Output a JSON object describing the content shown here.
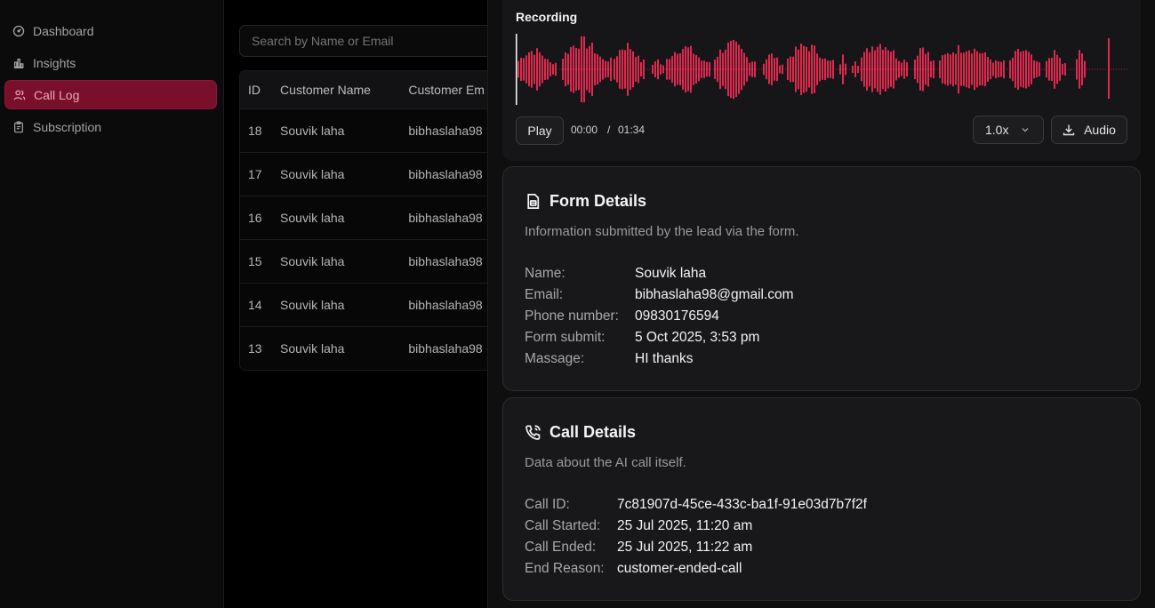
{
  "sidebar": {
    "items": [
      {
        "label": "Dashboard",
        "icon": "gauge-icon",
        "active": false
      },
      {
        "label": "Insights",
        "icon": "bar-chart-icon",
        "active": false
      },
      {
        "label": "Call Log",
        "icon": "users-icon",
        "active": true
      },
      {
        "label": "Subscription",
        "icon": "clipboard-icon",
        "active": false
      }
    ]
  },
  "search": {
    "placeholder": "Search by Name or Email"
  },
  "table": {
    "headers": [
      "ID",
      "Customer Name",
      "Customer Em"
    ],
    "rows": [
      [
        "18",
        "Souvik laha",
        "bibhaslaha98"
      ],
      [
        "17",
        "Souvik laha",
        "bibhaslaha98"
      ],
      [
        "16",
        "Souvik laha",
        "bibhaslaha98"
      ],
      [
        "15",
        "Souvik laha",
        "bibhaslaha98"
      ],
      [
        "14",
        "Souvik laha",
        "bibhaslaha98"
      ],
      [
        "13",
        "Souvik laha",
        "bibhaslaha98"
      ]
    ]
  },
  "recording": {
    "title": "Recording",
    "play_label": "Play",
    "current_time": "00:00",
    "separator": "/",
    "duration": "01:34",
    "speed": "1.0x",
    "download_label": "Audio",
    "progress": 0,
    "wave_color": "#e0294f"
  },
  "form_details": {
    "title": "Form Details",
    "description": "Information submitted by the lead via the form.",
    "fields": [
      {
        "key": "Name:",
        "value": "Souvik laha"
      },
      {
        "key": "Email:",
        "value": "bibhaslaha98@gmail.com"
      },
      {
        "key": "Phone number:",
        "value": "09830176594"
      },
      {
        "key": "Form submit:",
        "value": "5 Oct 2025, 3:53 pm"
      },
      {
        "key": "Massage:",
        "value": "HI thanks"
      }
    ]
  },
  "call_details": {
    "title": "Call Details",
    "description": "Data about the AI call itself.",
    "fields": [
      {
        "key": "Call ID:",
        "value": "7c81907d-45ce-433c-ba1f-91e03d7b7f2f"
      },
      {
        "key": "Call Started:",
        "value": "25 Jul 2025, 11:20 am"
      },
      {
        "key": "Call Ended:",
        "value": "25 Jul 2025, 11:22 am"
      },
      {
        "key": "End Reason:",
        "value": "customer-ended-call"
      }
    ]
  }
}
